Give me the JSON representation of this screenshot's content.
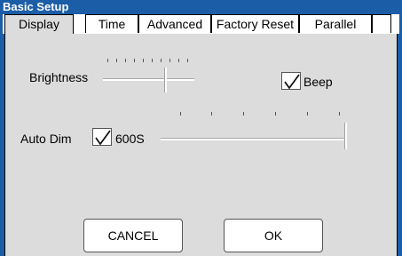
{
  "window": {
    "title": "Basic Setup"
  },
  "tabs": [
    {
      "label": "Display",
      "active": true
    },
    {
      "label": "Time",
      "active": false
    },
    {
      "label": "Advanced",
      "active": false
    },
    {
      "label": "Factory Reset",
      "active": false
    },
    {
      "label": "Parallel",
      "active": false
    }
  ],
  "display": {
    "brightness": {
      "label": "Brightness",
      "level_fraction": 0.7
    },
    "beep": {
      "label": "Beep",
      "checked": true
    },
    "auto_dim": {
      "label": "Auto Dim",
      "checked": true,
      "value_text": "600S",
      "level_fraction": 1.0
    }
  },
  "buttons": {
    "cancel": "CANCEL",
    "ok": "OK"
  },
  "colors": {
    "titlebar": "#1c5da8",
    "panel": "#dcdcdc",
    "title_text": "#ffffff"
  }
}
